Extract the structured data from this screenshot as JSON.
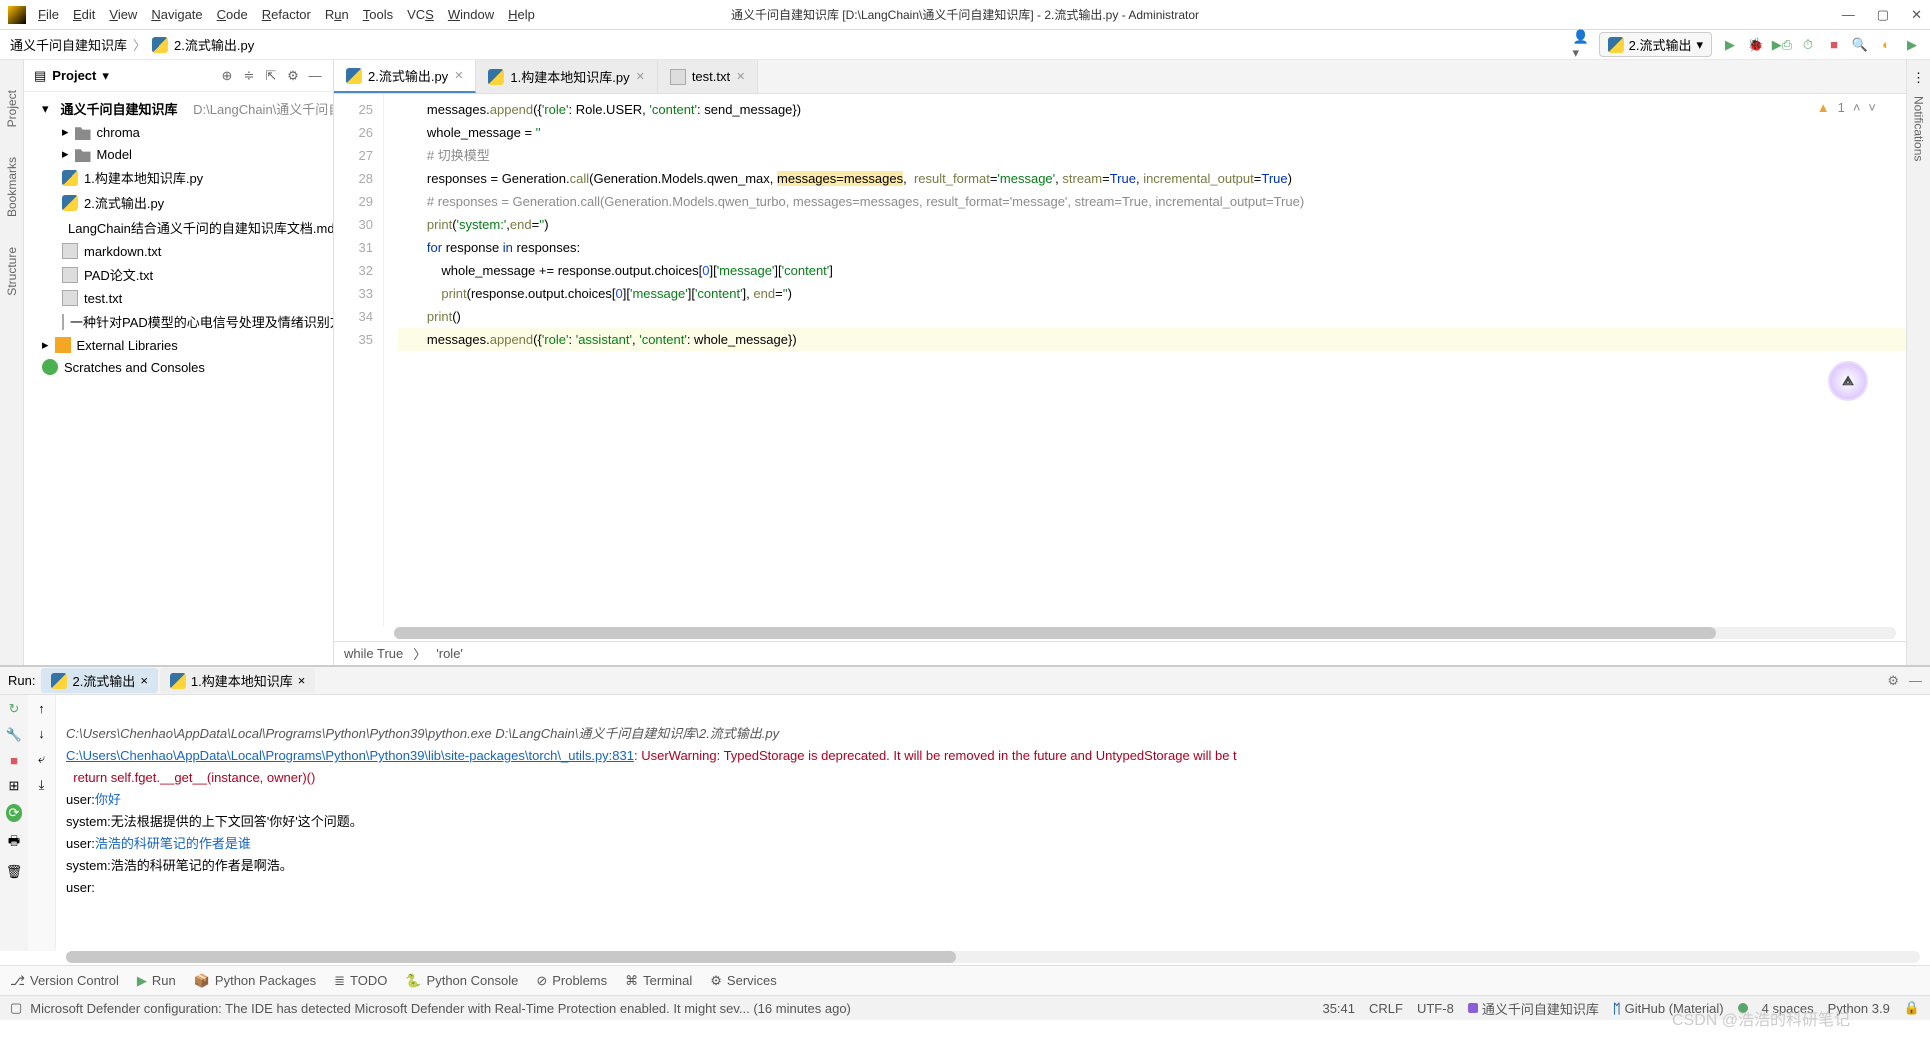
{
  "window": {
    "title": "通义千问自建知识库 [D:\\LangChain\\通义千问自建知识库] - 2.流式输出.py - Administrator"
  },
  "menu": [
    "File",
    "Edit",
    "View",
    "Navigate",
    "Code",
    "Refactor",
    "Run",
    "Tools",
    "VCS",
    "Window",
    "Help"
  ],
  "breadcrumb": {
    "root": "通义千问自建知识库",
    "file": "2.流式输出.py"
  },
  "run_config": {
    "name": "2.流式输出"
  },
  "project": {
    "title": "Project",
    "root": {
      "name": "通义千问自建知识库",
      "path": "D:\\LangChain\\通义千问自建知识库"
    },
    "children": [
      {
        "type": "folder",
        "name": "chroma"
      },
      {
        "type": "folder",
        "name": "Model"
      },
      {
        "type": "py",
        "name": "1.构建本地知识库.py"
      },
      {
        "type": "py",
        "name": "2.流式输出.py"
      },
      {
        "type": "md",
        "name": "LangChain结合通义千问的自建知识库文档.md"
      },
      {
        "type": "txt",
        "name": "markdown.txt"
      },
      {
        "type": "txt",
        "name": "PAD论文.txt"
      },
      {
        "type": "txt",
        "name": "test.txt"
      },
      {
        "type": "txt",
        "name": "一种针对PAD模型的心电信号处理及情绪识别方法"
      }
    ],
    "ext_lib": "External Libraries",
    "scratches": "Scratches and Consoles"
  },
  "tabs": [
    {
      "name": "2.流式输出.py",
      "active": true
    },
    {
      "name": "1.构建本地知识库.py",
      "active": false
    },
    {
      "name": "test.txt",
      "active": false
    }
  ],
  "editor": {
    "inspection": {
      "warnings": "1"
    },
    "lines": [
      {
        "n": 25,
        "html": "        messages.<span class='fn'>append</span>({<span class='str'>'role'</span>: Role.USER, <span class='str'>'content'</span>: send_message})"
      },
      {
        "n": 26,
        "html": "        whole_message = <span class='str'>''</span>"
      },
      {
        "n": 27,
        "html": "        <span class='cmt'># 切换模型</span>"
      },
      {
        "n": 28,
        "html": "        responses = Generation.<span class='fn'>call</span>(Generation.Models.qwen_max, <span class='hl'>messages=messages</span>,  <span class='fn'>result_format</span>=<span class='str'>'message'</span>, <span class='fn'>stream</span>=<span class='kw'>True</span>, <span class='fn'>incremental_output</span>=<span class='kw'>True</span>)"
      },
      {
        "n": 29,
        "html": "        <span class='cmt'># responses = Generation.call(Generation.Models.qwen_turbo, messages=messages, result_format='message', stream=True, incremental_output=True)</span>"
      },
      {
        "n": 30,
        "html": "        <span class='fn'>print</span>(<span class='str'>'system:'</span>,<span class='fn'>end</span>=<span class='str'>''</span>)"
      },
      {
        "n": 31,
        "html": "        <span class='kw'>for</span> response <span class='kw'>in</span> responses:"
      },
      {
        "n": 32,
        "html": "            whole_message += response.output.choices[<span class='num'>0</span>][<span class='str'>'message'</span>][<span class='str'>'content'</span>]"
      },
      {
        "n": 33,
        "html": "            <span class='fn'>print</span>(response.output.choices[<span class='num'>0</span>][<span class='str'>'message'</span>][<span class='str'>'content'</span>], <span class='fn'>end</span>=<span class='str'>''</span>)"
      },
      {
        "n": 34,
        "html": "        <span class='fn'>print</span>()"
      },
      {
        "n": 35,
        "html": "        messages.<span class='fn'>append</span>({<span class='str'>'role'</span>: <span class='str'>'assistant'</span>, <span class='str'>'content'</span>: whole_message})",
        "cur": true
      }
    ],
    "crumbs": [
      "while True",
      "'role'"
    ]
  },
  "run": {
    "label": "Run:",
    "tabs": [
      {
        "name": "2.流式输出",
        "active": true
      },
      {
        "name": "1.构建本地知识库",
        "active": false
      }
    ],
    "out": {
      "cmd": "C:\\Users\\Chenhao\\AppData\\Local\\Programs\\Python\\Python39\\python.exe D:\\LangChain\\通义千问自建知识库\\2.流式输出.py",
      "warn_link": "C:\\Users\\Chenhao\\AppData\\Local\\Programs\\Python\\Python39\\lib\\site-packages\\torch\\_utils.py:831",
      "warn_text": ": UserWarning: TypedStorage is deprecated. It will be removed in the future and UntypedStorage will be t",
      "warn_l2": "  return self.fget.__get__(instance, owner)()",
      "l1a": "user:",
      "l1b": "你好",
      "l2": "system:无法根据提供的上下文回答'你好'这个问题。",
      "l3a": "user:",
      "l3b": "浩浩的科研笔记的作者是谁",
      "l4": "system:浩浩的科研笔记的作者是啊浩。",
      "l5": "user:"
    }
  },
  "bottom": [
    "Version Control",
    "Run",
    "Python Packages",
    "TODO",
    "Python Console",
    "Problems",
    "Terminal",
    "Services"
  ],
  "status": {
    "msg": "Microsoft Defender configuration: The IDE has detected Microsoft Defender with Real-Time Protection enabled. It might sev... (16 minutes ago)",
    "pos": "35:41",
    "eol": "CRLF",
    "enc": "UTF-8",
    "proj": "通义千问自建知识库",
    "git": "GitHub (Material)",
    "indent": "4 spaces",
    "py": "Python 3.9"
  },
  "side_tabs": {
    "project": "Project",
    "bookmarks": "Bookmarks",
    "structure": "Structure",
    "notifications": "Notifications"
  },
  "watermark": "CSDN @浩浩的科研笔记"
}
